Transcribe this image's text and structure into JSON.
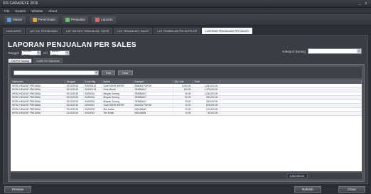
{
  "window": {
    "title": "SIS CARADEXE 2016",
    "controls": [
      "_",
      "x"
    ]
  },
  "menu": [
    "File",
    "System",
    "Window",
    "About"
  ],
  "toolbar": [
    {
      "label": "Master",
      "icon": "database-icon",
      "color": "#5aa0e0"
    },
    {
      "label": "Penerimaan",
      "icon": "inbox-icon",
      "color": "#e0a64a"
    },
    {
      "label": "Penjualan",
      "icon": "cart-icon",
      "color": "#6cc070"
    },
    {
      "label": "Laporan",
      "icon": "report-icon",
      "color": "#d76a6a"
    }
  ],
  "doc_tabs": [
    {
      "label": "DATA SUPIR",
      "active": false
    },
    {
      "label": "LAP. INV. PERSEDIAAN",
      "active": false
    },
    {
      "label": "LAP. HISTORY PENJUALAN / SUPIR",
      "active": false
    },
    {
      "label": "LAP. PENJUALAN / SALES",
      "active": false
    },
    {
      "label": "LAP. PEMBELIAN PER SUPPLIER",
      "active": false
    },
    {
      "label": "LAPORAN PENJUALAN PER SALES",
      "active": true
    }
  ],
  "page_title": "LAPORAN PENJUALAN PER SALES",
  "filters": {
    "tanggal_label": "Tanggal",
    "date_from": "01-10-2014",
    "sd_label": "s/d",
    "date_to": "31-07-2016",
    "kategori_label": "Kategori Barang",
    "kategori_value": ""
  },
  "inner_tabs": [
    {
      "label": "Grid Per Barang",
      "active": true
    },
    {
      "label": "Grafik Per Salesman",
      "active": false
    }
  ],
  "grid_toolbar": {
    "search_value": "",
    "buttons": [
      "Find",
      "Clear"
    ]
  },
  "table": {
    "columns": [
      "Salesman",
      "Tanggal",
      "Kode Brg",
      "Nama",
      "Kategori",
      "Qty Jual",
      "Total"
    ],
    "rows": [
      [
        "HERU HIDAYAT PRATAMA",
        "20/10/2015",
        "BK00001S",
        "Gula PASIR IMPOR",
        "BAHAN POKOK",
        "1,000.00",
        "1,250,000.00"
      ],
      [
        "HERU HIDAYAT PRATAMA",
        "20/10/2015",
        "BK00017A",
        "Gula Merah",
        "SEMBAKO",
        "100.00",
        "1,475,000.00"
      ],
      [
        "HERU HIDAYAT PRATAMA",
        "20/10/2015",
        "BK00016",
        "Minyak Goreng",
        "SEMBAKO",
        "30.00",
        "1,240,000.00"
      ],
      [
        "HERU HIDAYAT PRATAMA",
        "20/10/2015",
        "BK00016",
        "Minyak Goreng",
        "SEMBAKO",
        "50.00",
        "300,000.00"
      ],
      [
        "HERU HIDAYAT PRATAMA",
        "20/10/2015",
        "BK00016",
        "Minyak Goreng",
        "SEMBAKO",
        "25.00",
        "300,000.00"
      ],
      [
        "HERU HIDAYAT PRATAMA",
        "20/10/2015",
        "BK00002",
        "Gula PASIR IMPOR",
        "BAHAN POKOK",
        "10.00",
        "625,000.00"
      ],
      [
        "HERU HIDAYAT PRATAMA",
        "21/10/2015",
        "BK00078",
        "Mie Instan",
        "MAKANAN",
        "20.00",
        "120,000.00"
      ],
      [
        "HERU HIDAYAT PRATAMA",
        "21/10/2015",
        "BK00004",
        "Teh Kotak",
        "MINUMAN",
        "10.00",
        "30,000.00"
      ]
    ]
  },
  "grid_footer": {
    "total_label": "5,340,000.00"
  },
  "bottom_buttons": {
    "preview": "Preview",
    "refresh": "Refresh",
    "close": "Close"
  }
}
